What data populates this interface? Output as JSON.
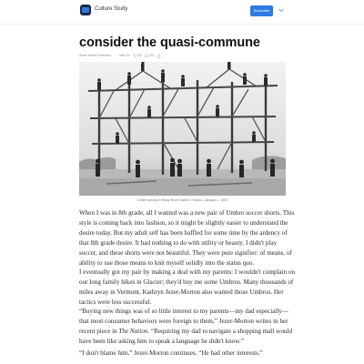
{
  "header": {
    "publication": "Culture Study",
    "subscribe_label": "Subscribe",
    "logo_icon": "publication-logo-icon",
    "menu_icon": "chevron-down-icon",
    "accent_color": "#2f7be0"
  },
  "post": {
    "title": "consider the quasi-commune",
    "author": "Anne Helen Petersen",
    "date": "Mar 14",
    "likes": "62",
    "comments": "31"
  },
  "photo": {
    "caption": "A barn raising in Rainy River District, Ontario, Canada, c. 1900"
  },
  "body": {
    "p1": [
      "When I was in 8th grade, all I wanted was a new pair of Umbro soccer shorts. This",
      "style is coming back into fashion, so it might be slightly easier to understand the",
      "desire today. But my adult self has been baffled for some time by the ardency of",
      "that 8th grade desire. It had nothing to do with utility or beauty. I didn't play",
      "soccer, and these shorts were not beautiful. They were pure signifier: of means, of",
      "ability to use those means to knit myself solidly into the status quo."
    ],
    "p2": [
      "I eventually got my pair by making a deal with my parents: I wouldn't complain on",
      "our long family hikes in Glacier; they'd buy me some Umbros. Many thousands of",
      "miles away in Vermont, Kathryn Jezer-Morton also wanted those Umbros. Her",
      "tactics were less successful."
    ],
    "p3": [
      "“Buying new things was of so little interest to my parents—my dad especially—",
      "that most consumer behaviors were foreign to them,” Jezer-Morton writes in her",
      "recent piece in ",
      "The Nation",
      ". “Requiring my dad to navigate a shopping mall would",
      "have been like asking him to speak a language he didn't know.”"
    ],
    "p4": [
      "“I don't blame him,” Jezer-Morton continues. “He had other interests.”"
    ]
  }
}
